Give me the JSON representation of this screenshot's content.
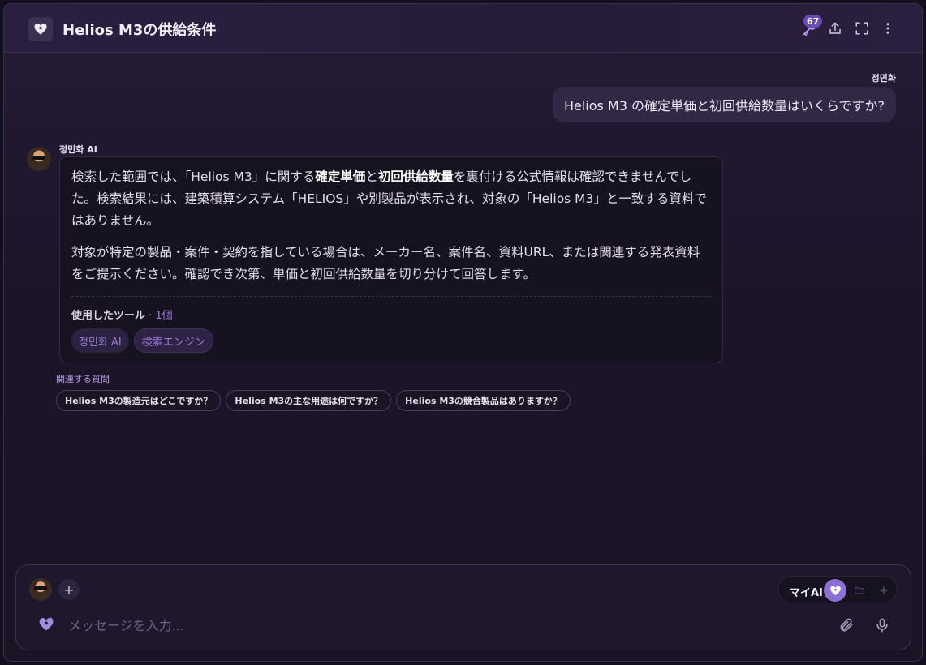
{
  "header": {
    "title": "Helios M3の供給条件",
    "badge_count": "67"
  },
  "user_message": {
    "sender": "정민화",
    "text": "Helios M3 の確定単価と初回供給数量はいくらですか?"
  },
  "ai_message": {
    "sender": "정민화 AI",
    "p1_a": "検索した範囲では、「Helios M3」に関する",
    "p1_b1": "確定単価",
    "p1_c": "と",
    "p1_b2": "初回供給数量",
    "p1_d": "を裏付ける公式情報は確認できませんでした。検索結果には、建築積算システム「HELIOS」や別製品が表示され、対象の「Helios M3」と一致する資料ではありません。",
    "p2": "対象が特定の製品・案件・契約を指している場合は、メーカー名、案件名、資料URL、または関連する発表資料をご提示ください。確認でき次第、単価と初回供給数量を切り分けて回答します。",
    "tools_label": "使用したツール",
    "tools_count": " · 1個",
    "tool_chips": [
      "정민화 AI",
      "検索エンジン"
    ]
  },
  "related": {
    "label": "関連する質問",
    "questions": [
      "Helios M3の製造元はどこですか？",
      "Helios M3の主な用途は何ですか？",
      "Helios M3の競合製品はありますか？"
    ]
  },
  "composer": {
    "placeholder": "メッセージを入力...",
    "mode_label": "マイAI"
  },
  "colors": {
    "accent": "#8e6fd6",
    "chip_text": "#9b7ad9",
    "background": "#1c1529"
  }
}
